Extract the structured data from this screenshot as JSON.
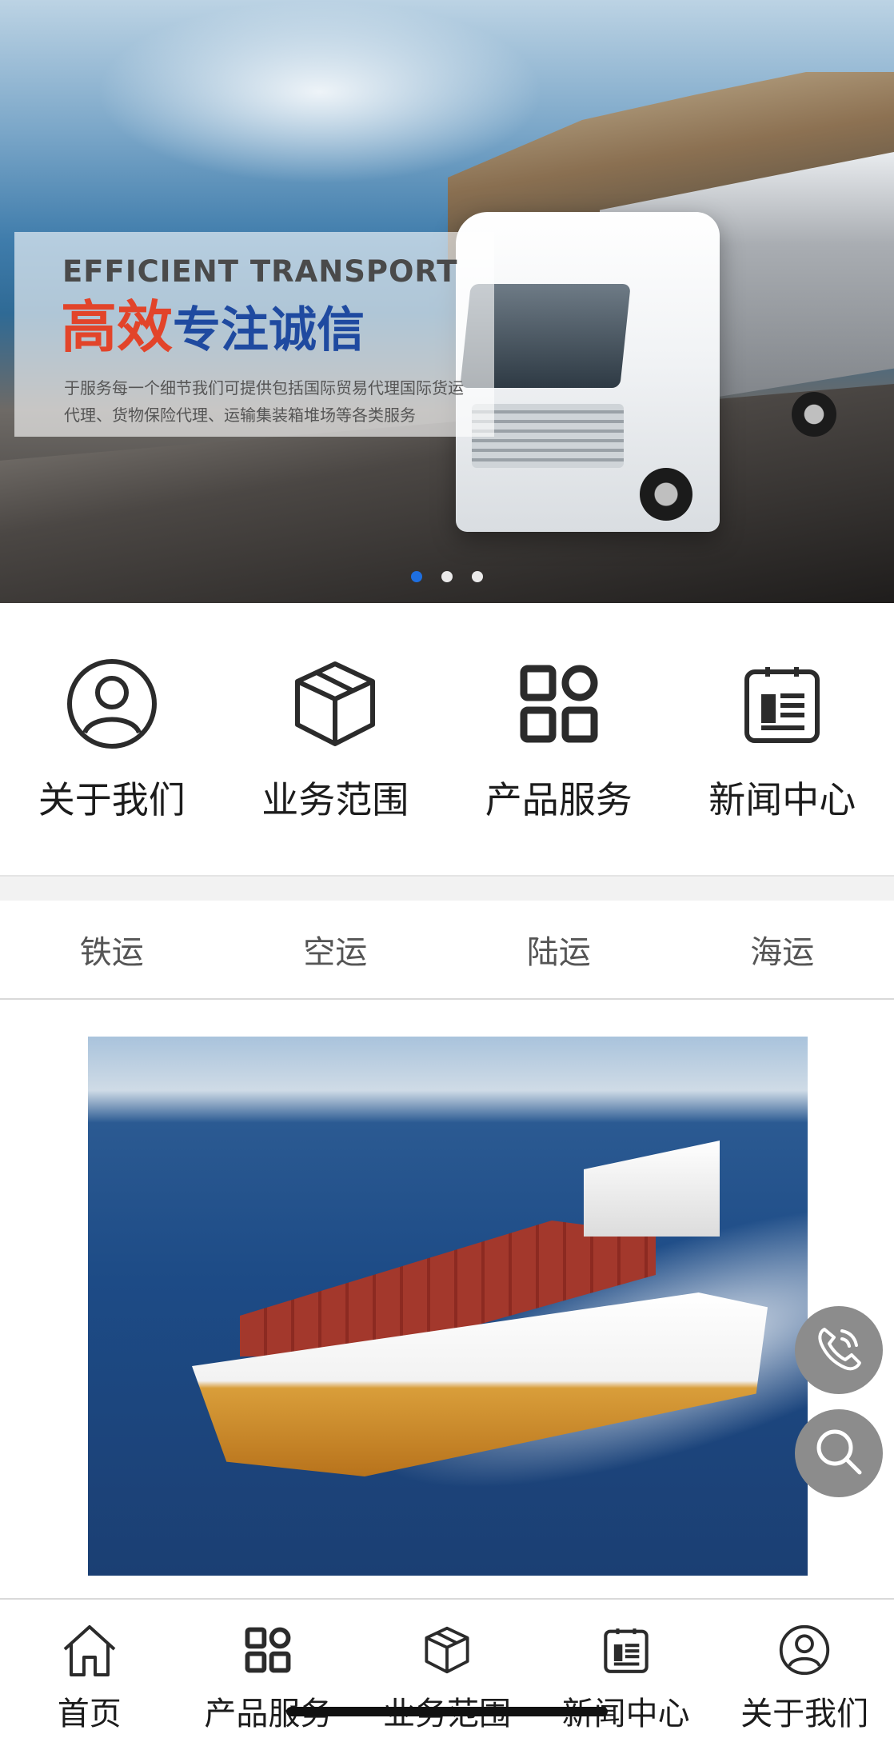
{
  "hero": {
    "eng_title": "EFFICIENT TRANSPORT",
    "cn_title_red": "高效",
    "cn_title_blue": "专注诚信",
    "subtitle_line1": "于服务每一个细节我们可提供包括国际贸易代理国际货运",
    "subtitle_line2": "代理、货物保险代理、运输集装箱堆场等各类服务",
    "slides": 3,
    "active_slide": 1
  },
  "quick_nav": [
    {
      "label": "关于我们",
      "icon": "user-icon"
    },
    {
      "label": "业务范围",
      "icon": "box-icon"
    },
    {
      "label": "产品服务",
      "icon": "grid-icon"
    },
    {
      "label": "新闻中心",
      "icon": "news-icon"
    }
  ],
  "tabs": [
    "铁运",
    "空运",
    "陆运",
    "海运"
  ],
  "floating": {
    "phone_icon": "phone-icon",
    "search_icon": "search-icon"
  },
  "bottom_nav": [
    {
      "label": "首页",
      "icon": "home-icon"
    },
    {
      "label": "产品服务",
      "icon": "grid-icon"
    },
    {
      "label": "业务范围",
      "icon": "box-icon"
    },
    {
      "label": "新闻中心",
      "icon": "news-icon"
    },
    {
      "label": "关于我们",
      "icon": "user-icon"
    }
  ],
  "colors": {
    "accent_blue": "#1e6fe0",
    "title_red": "#e2442a",
    "title_blue": "#1f4aa0",
    "fab_gray": "#8c8c8c"
  }
}
